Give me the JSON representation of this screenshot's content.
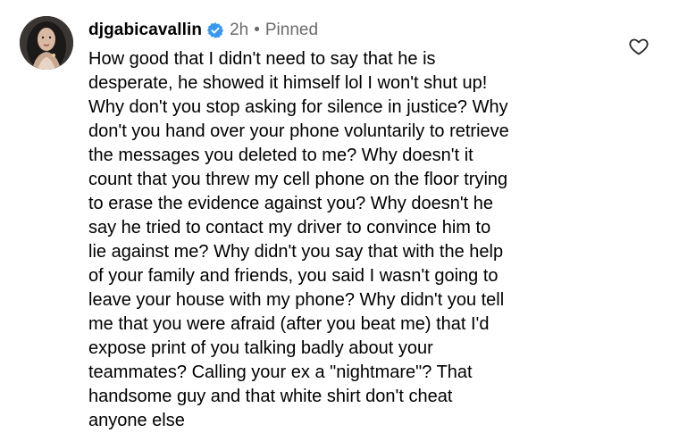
{
  "comment": {
    "username": "djgabicavallin",
    "verified_icon": "verified-badge-icon",
    "time": "2h",
    "separator": "•",
    "pinned_label": "Pinned",
    "like_icon": "heart-outline-icon",
    "accent_color": "#3897f0",
    "lines": [
      "How good that I didn't need to say that he is",
      "desperate, he showed it himself lol I won't shut up!",
      "Why don't you stop asking for silence in justice? Why",
      "don't you hand over your phone voluntarily to retrieve",
      "the messages you deleted to me? Why doesn't it",
      "count that you threw my cell phone on the floor trying",
      "to erase the evidence against you? Why doesn't he",
      "say he tried to contact my driver to convince him to",
      "lie against me? Why didn't you say that with the help",
      "of your family and friends, you said I wasn't going to",
      "leave your house with my phone? Why didn't you tell",
      "me that you were afraid (after you beat me) that I'd",
      "expose print of you talking badly about your",
      "teammates? Calling your ex a \"nightmare\"? That",
      "handsome guy and that white shirt don't cheat",
      "anyone else"
    ]
  }
}
